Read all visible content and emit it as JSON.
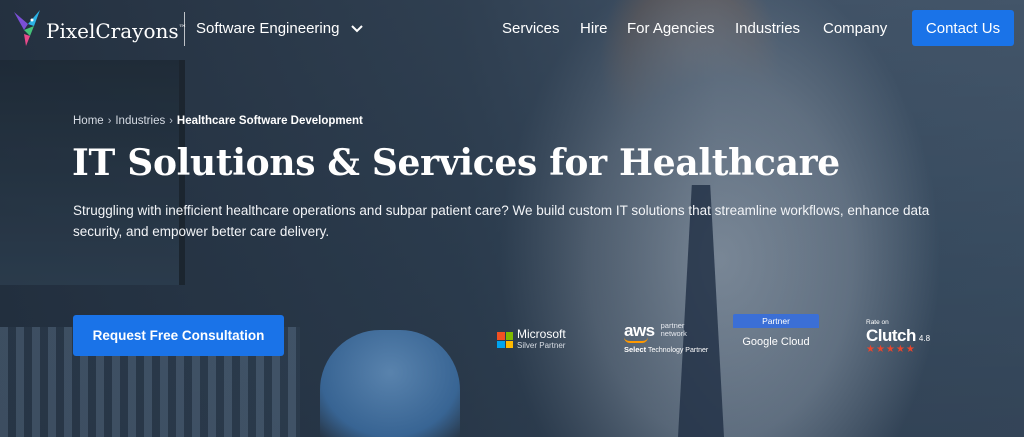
{
  "brand": {
    "name": "PixelCrayons",
    "tm": "™"
  },
  "category_selector": {
    "label": "Software Engineering",
    "icon": "chevron-down-icon"
  },
  "nav": {
    "items": [
      "Services",
      "Hire",
      "For Agencies",
      "Industries",
      "Company"
    ],
    "contact_label": "Contact Us"
  },
  "breadcrumb": {
    "items": [
      "Home",
      "Industries",
      "Healthcare Software Development"
    ],
    "separator": "›"
  },
  "hero": {
    "title": "IT Solutions & Services for Healthcare",
    "subtitle": "Struggling with inefficient healthcare operations and subpar patient care? We build custom IT solutions that streamline workflows, enhance data security, and empower better care delivery.",
    "cta_label": "Request Free Consultation"
  },
  "badges": {
    "microsoft": {
      "name": "Microsoft",
      "sub": "Silver Partner"
    },
    "aws": {
      "logo": "aws",
      "partner_line1": "partner",
      "partner_line2": "network",
      "select": "Select",
      "tier": "Technology Partner"
    },
    "google": {
      "top": "Partner",
      "name": "Google Cloud"
    },
    "clutch": {
      "rate_on": "Rate on",
      "name": "Clutch",
      "score": "4.8",
      "stars": "★★★★★"
    }
  },
  "colors": {
    "primary": "#1a73e8",
    "aws_orange": "#ff9900",
    "clutch_red": "#e8452c"
  }
}
